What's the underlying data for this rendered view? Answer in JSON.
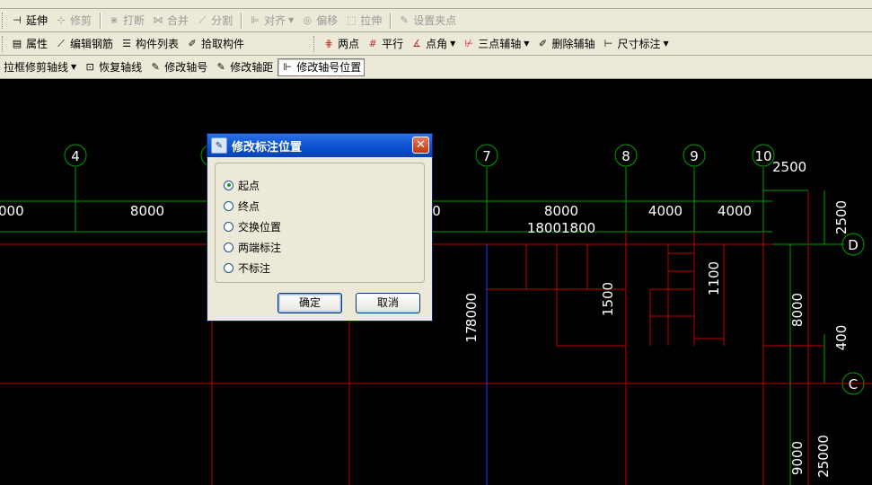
{
  "toolbar1": {
    "items": [
      {
        "label": "延伸",
        "enabled": true,
        "icon": "extend-icon"
      },
      {
        "label": "修剪",
        "enabled": false,
        "icon": "trim-icon"
      },
      {
        "label": "打断",
        "enabled": false,
        "icon": "break-icon"
      },
      {
        "label": "合并",
        "enabled": false,
        "icon": "merge-icon"
      },
      {
        "label": "分割",
        "enabled": false,
        "icon": "split-icon"
      },
      {
        "label": "对齐",
        "enabled": false,
        "icon": "align-icon"
      },
      {
        "label": "偏移",
        "enabled": false,
        "icon": "offset-icon"
      },
      {
        "label": "拉伸",
        "enabled": false,
        "icon": "stretch-icon"
      },
      {
        "label": "设置夹点",
        "enabled": false,
        "icon": "grip-point-icon"
      }
    ]
  },
  "toolbar2": {
    "left": [
      {
        "label": "属性",
        "icon": "properties-icon"
      },
      {
        "label": "编辑钢筋",
        "icon": "edit-rebar-icon"
      },
      {
        "label": "构件列表",
        "icon": "component-list-icon"
      },
      {
        "label": "拾取构件",
        "icon": "pick-component-icon"
      }
    ],
    "right": [
      {
        "label": "两点",
        "icon": "two-point-icon"
      },
      {
        "label": "平行",
        "icon": "parallel-icon"
      },
      {
        "label": "点角",
        "icon": "point-angle-icon"
      },
      {
        "label": "三点辅轴",
        "icon": "three-point-axis-icon"
      },
      {
        "label": "删除辅轴",
        "icon": "delete-axis-icon"
      },
      {
        "label": "尺寸标注",
        "icon": "dimension-icon"
      }
    ]
  },
  "toolbar3": {
    "items": [
      {
        "label": "拉框修剪轴线",
        "icon": ""
      },
      {
        "label": "恢复轴线",
        "icon": "restore-axis-icon"
      },
      {
        "label": "修改轴号",
        "icon": "edit-axis-number-icon"
      },
      {
        "label": "修改轴距",
        "icon": "edit-axis-spacing-icon"
      },
      {
        "label": "修改轴号位置",
        "icon": "edit-axis-position-icon"
      }
    ]
  },
  "drawing": {
    "axis_labels_top": [
      "4",
      "7",
      "8",
      "9",
      "10"
    ],
    "axis_labels_right": [
      "D",
      "C"
    ],
    "dims_top": [
      "000",
      "8000",
      "0",
      "8000",
      "4000",
      "4000"
    ],
    "dims_top_far_right": "2500",
    "dims_second_row": "18001800",
    "dims_vertical": [
      "2500",
      "8000",
      "400",
      "1500",
      "1100",
      "9000",
      "25000",
      "17",
      "8000"
    ],
    "colors": {
      "grid": "#00a000",
      "walls": "#c00000",
      "axis_blue": "#1a3cff",
      "text": "#ffffff",
      "background": "#000000"
    }
  },
  "dialog": {
    "title": "修改标注位置",
    "options": [
      "起点",
      "终点",
      "交换位置",
      "两端标注",
      "不标注"
    ],
    "selected_index": 0,
    "ok": "确定",
    "cancel": "取消"
  }
}
